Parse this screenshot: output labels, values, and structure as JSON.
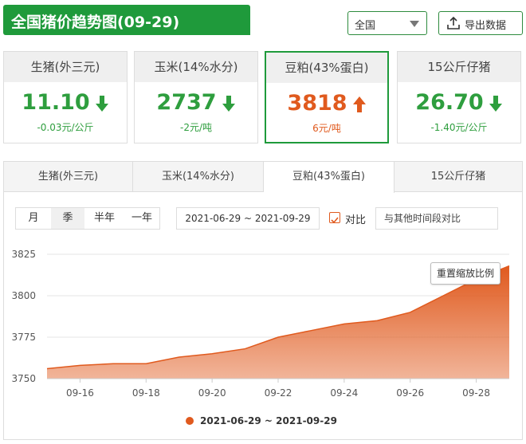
{
  "header": {
    "title": "全国猪价趋势图(09-29)",
    "region": "全国",
    "export_label": "导出数据"
  },
  "cards": [
    {
      "name": "生猪(外三元)",
      "price": "11.10",
      "change": "-0.03元/公斤",
      "direction": "down"
    },
    {
      "name": "玉米(14%水分)",
      "price": "2737",
      "change": "-2元/吨",
      "direction": "down"
    },
    {
      "name": "豆粕(43%蛋白)",
      "price": "3818",
      "change": "6元/吨",
      "direction": "up",
      "active": true
    },
    {
      "name": "15公斤仔猪",
      "price": "26.70",
      "change": "-1.40元/公斤",
      "direction": "down"
    }
  ],
  "tabs": [
    "生猪(外三元)",
    "玉米(14%水分)",
    "豆粕(43%蛋白)",
    "15公斤仔猪"
  ],
  "active_tab": 2,
  "periods": [
    "月",
    "季",
    "半年",
    "一年"
  ],
  "active_period": 1,
  "date_range": "2021-06-29 ~ 2021-09-29",
  "compare_label": "对比",
  "compare_placeholder": "与其他时间段对比",
  "reset_zoom_label": "重置缩放比例",
  "colors": {
    "brand_green": "#1f9a3b",
    "down_green": "#2e9e3e",
    "up_orange": "#e05a1e"
  },
  "chart_data": {
    "type": "area",
    "x": [
      "09-15",
      "09-16",
      "09-17",
      "09-18",
      "09-19",
      "09-20",
      "09-21",
      "09-22",
      "09-23",
      "09-24",
      "09-25",
      "09-26",
      "09-27",
      "09-28",
      "09-29"
    ],
    "xticks": [
      "09-16",
      "09-18",
      "09-20",
      "09-22",
      "09-24",
      "09-26",
      "09-28"
    ],
    "series": [
      {
        "name": "2021-06-29 ~ 2021-09-29",
        "values": [
          3756,
          3758,
          3759,
          3759,
          3763,
          3765,
          3768,
          3775,
          3779,
          3783,
          3785,
          3790,
          3800,
          3810,
          3818
        ]
      }
    ],
    "ylim": [
      3750,
      3825
    ],
    "yticks": [
      3750,
      3775,
      3800,
      3825
    ],
    "grid": true,
    "legend": "bottom",
    "color": "#e05a1e"
  }
}
